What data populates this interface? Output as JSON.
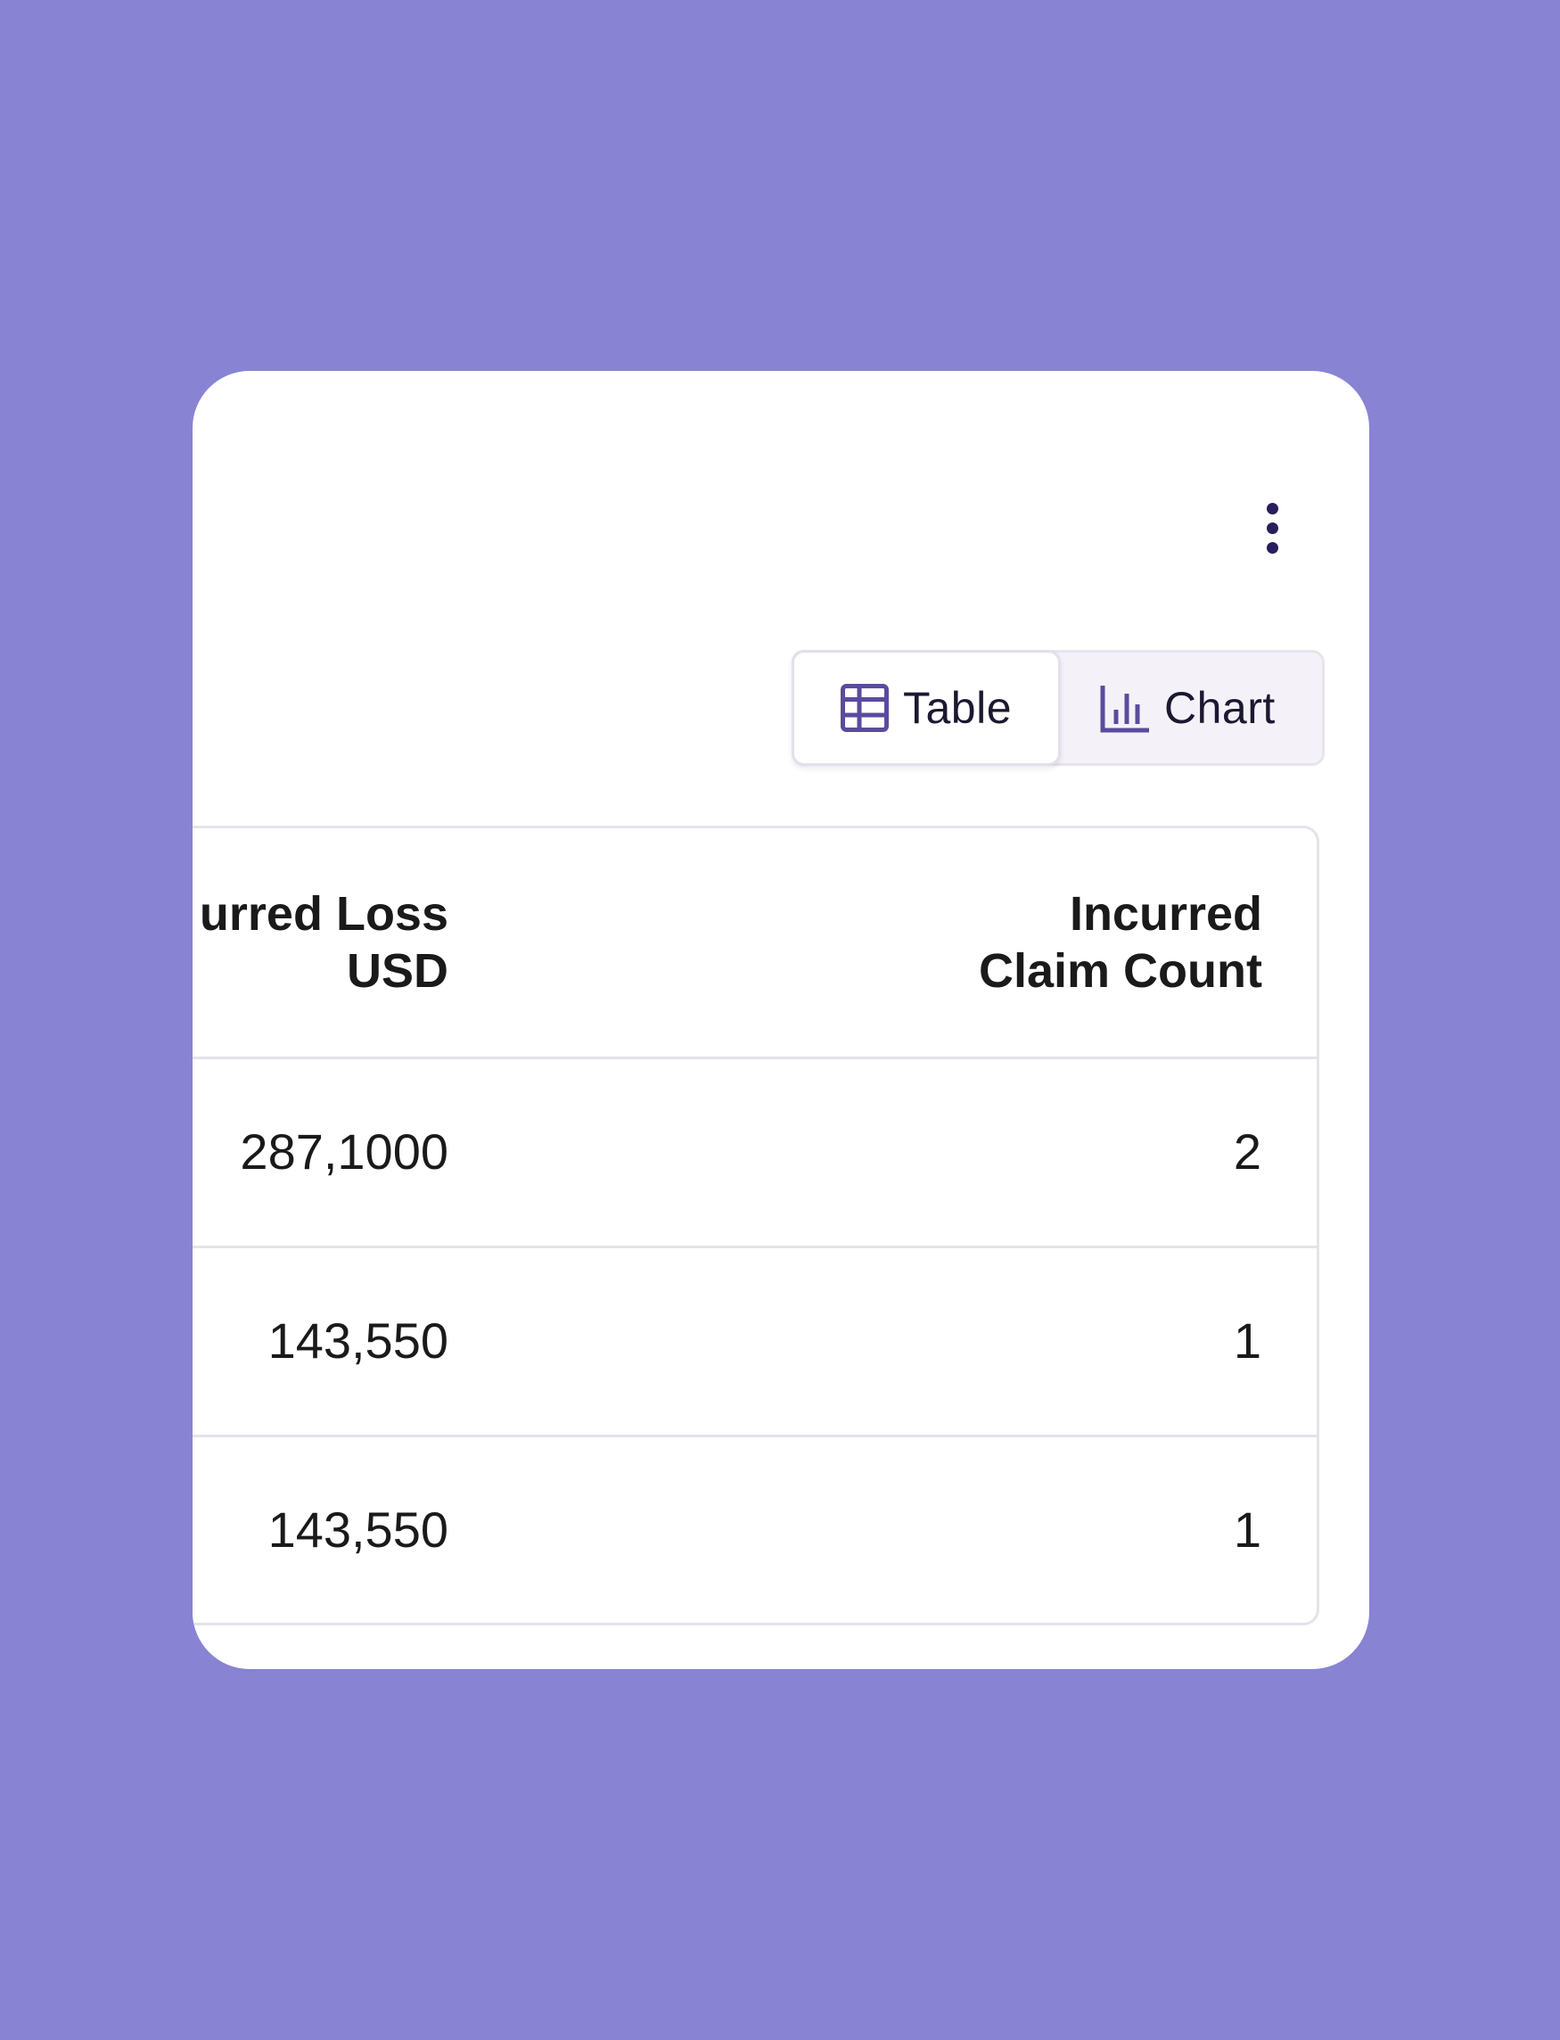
{
  "menu": {
    "icon": "more-vertical-icon"
  },
  "view_toggle": {
    "table_label": "Table",
    "chart_label": "Chart",
    "selected": "Table",
    "accent_color": "#5b4b9e",
    "table_icon": "table-grid-icon",
    "chart_icon": "bar-chart-icon"
  },
  "table": {
    "columns": [
      {
        "line1": "urred Loss",
        "line2": "USD"
      },
      {
        "line1": "Incurred",
        "line2": "Claim Count"
      }
    ],
    "rows": [
      {
        "incurred_loss_usd": "287,1000",
        "incurred_claim_count": "2"
      },
      {
        "incurred_loss_usd": "143,550",
        "incurred_claim_count": "1"
      },
      {
        "incurred_loss_usd": "143,550",
        "incurred_claim_count": "1"
      }
    ]
  },
  "colors": {
    "background": "#8883d3",
    "card": "#ffffff",
    "text": "#1a1a1a",
    "border": "#e4e3ea"
  }
}
